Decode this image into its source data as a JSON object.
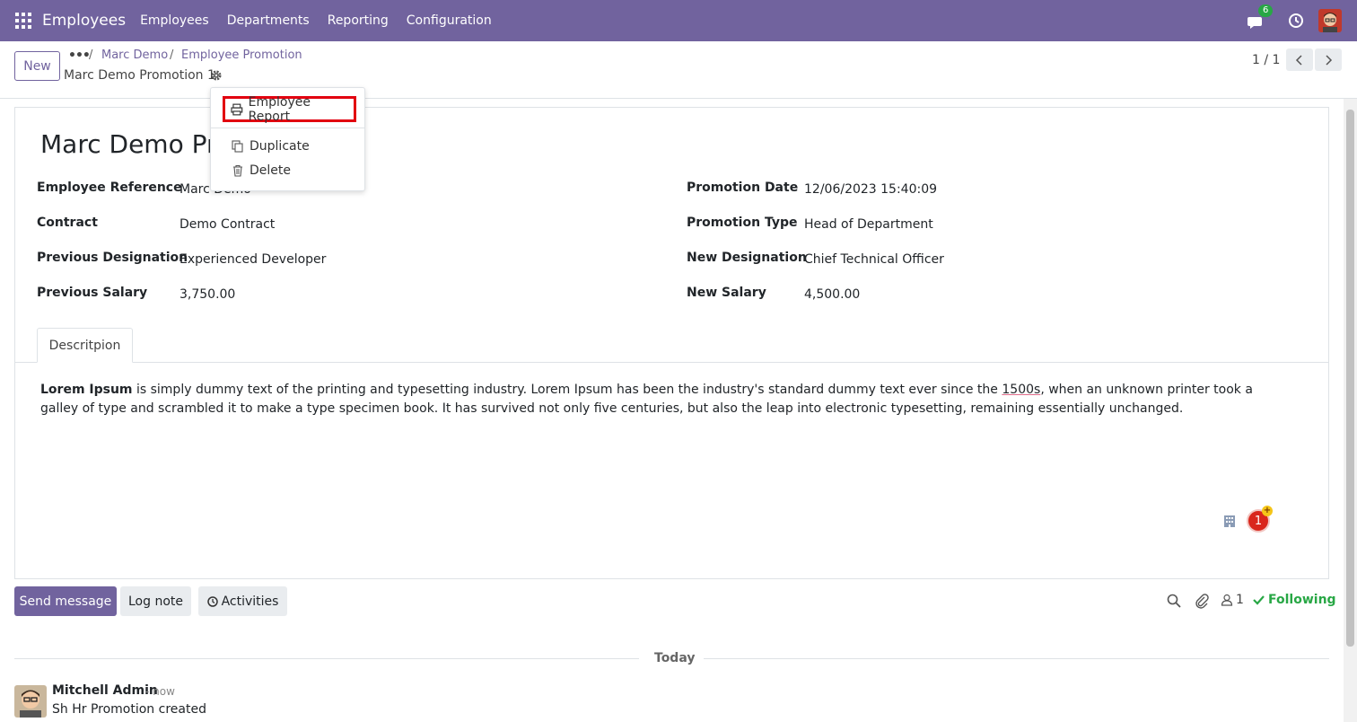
{
  "navbar": {
    "app_title": "Employees",
    "menu": [
      "Employees",
      "Departments",
      "Reporting",
      "Configuration"
    ],
    "chat_badge": "6",
    "accent": "#71639e"
  },
  "control": {
    "new_label": "New",
    "breadcrumb_dots": "•••",
    "breadcrumb": [
      "Marc Demo",
      "Employee Promotion"
    ],
    "record_name": "Marc Demo Promotion 1",
    "pager": "1 / 1"
  },
  "dropdown": {
    "employee_report": "Employee Report",
    "duplicate": "Duplicate",
    "delete": "Delete"
  },
  "form": {
    "title": "Marc Demo Pro",
    "left": [
      {
        "label": "Employee Reference",
        "value": "Marc Demo"
      },
      {
        "label": "Contract",
        "value": "Demo Contract"
      },
      {
        "label": "Previous Designation",
        "value": "Experienced Developer"
      },
      {
        "label": "Previous Salary",
        "value": "3,750.00"
      }
    ],
    "right": [
      {
        "label": "Promotion Date",
        "value": "12/06/2023 15:40:09"
      },
      {
        "label": "Promotion Type",
        "value": "Head of Department"
      },
      {
        "label": "New Designation",
        "value": "Chief Technical Officer"
      },
      {
        "label": "New Salary",
        "value": "4,500.00"
      }
    ],
    "tab_label": "Descritpion",
    "description": {
      "bold": "Lorem Ipsum",
      "part1": " is simply dummy text of the printing and typesetting industry. Lorem Ipsum has been the industry's standard dummy text ever since the ",
      "underlined": "1500s",
      "part2": ", when an unknown printer took a galley of type and scrambled it to make a type specimen book. It has survived not only five centuries, but also the leap into electronic typesetting, remaining essentially unchanged."
    },
    "notification_count": "1",
    "notification_plus": "+"
  },
  "chatter": {
    "send_message": "Send message",
    "log_note": "Log note",
    "activities": "Activities",
    "followers_count": "1",
    "following": "Following",
    "date_separator": "Today",
    "message": {
      "author": "Mitchell Admin",
      "time": "- now",
      "body": "Sh Hr Promotion created"
    }
  }
}
